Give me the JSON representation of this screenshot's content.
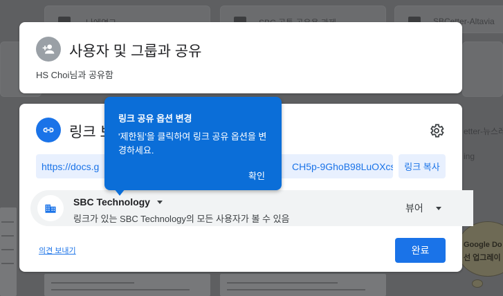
{
  "background": {
    "folders": [
      "나에연그",
      "SBC 공통 공유용 과제",
      "SBCetter-Altavia"
    ],
    "right_items": [
      "etter-뉴스레",
      "ing"
    ],
    "bubble_lines": [
      "Google Do",
      "선 업그레이"
    ]
  },
  "share_people": {
    "title": "사용자 및 그룹과 공유",
    "owner_text": "HS Choi님과 공유함"
  },
  "link_section": {
    "title": "링크 보",
    "url_left": "https://docs.g",
    "url_right": "CH5p-9GhoB98LuOXcs...",
    "copy_label": "링크 복사",
    "org_name": "SBC Technology",
    "org_desc": "링크가 있는 SBC Technology의 모든 사용자가 볼 수 있음",
    "role": "뷰어",
    "feedback_label": "의견 보내기",
    "done_label": "완료"
  },
  "tooltip": {
    "title": "링크 공유 옵션 변경",
    "body": "'제한됨'을 클릭하여 링크 공유 옵션을 변경하세요.",
    "ok_label": "확인"
  },
  "colors": {
    "accent": "#1a73e8",
    "tooltip_bg": "#0b6ed8",
    "person_avatar": "#9aa0a6"
  },
  "icons": {
    "person_add": "person-add-icon",
    "link": "link-icon",
    "settings": "gear-icon",
    "organization": "building-icon"
  }
}
